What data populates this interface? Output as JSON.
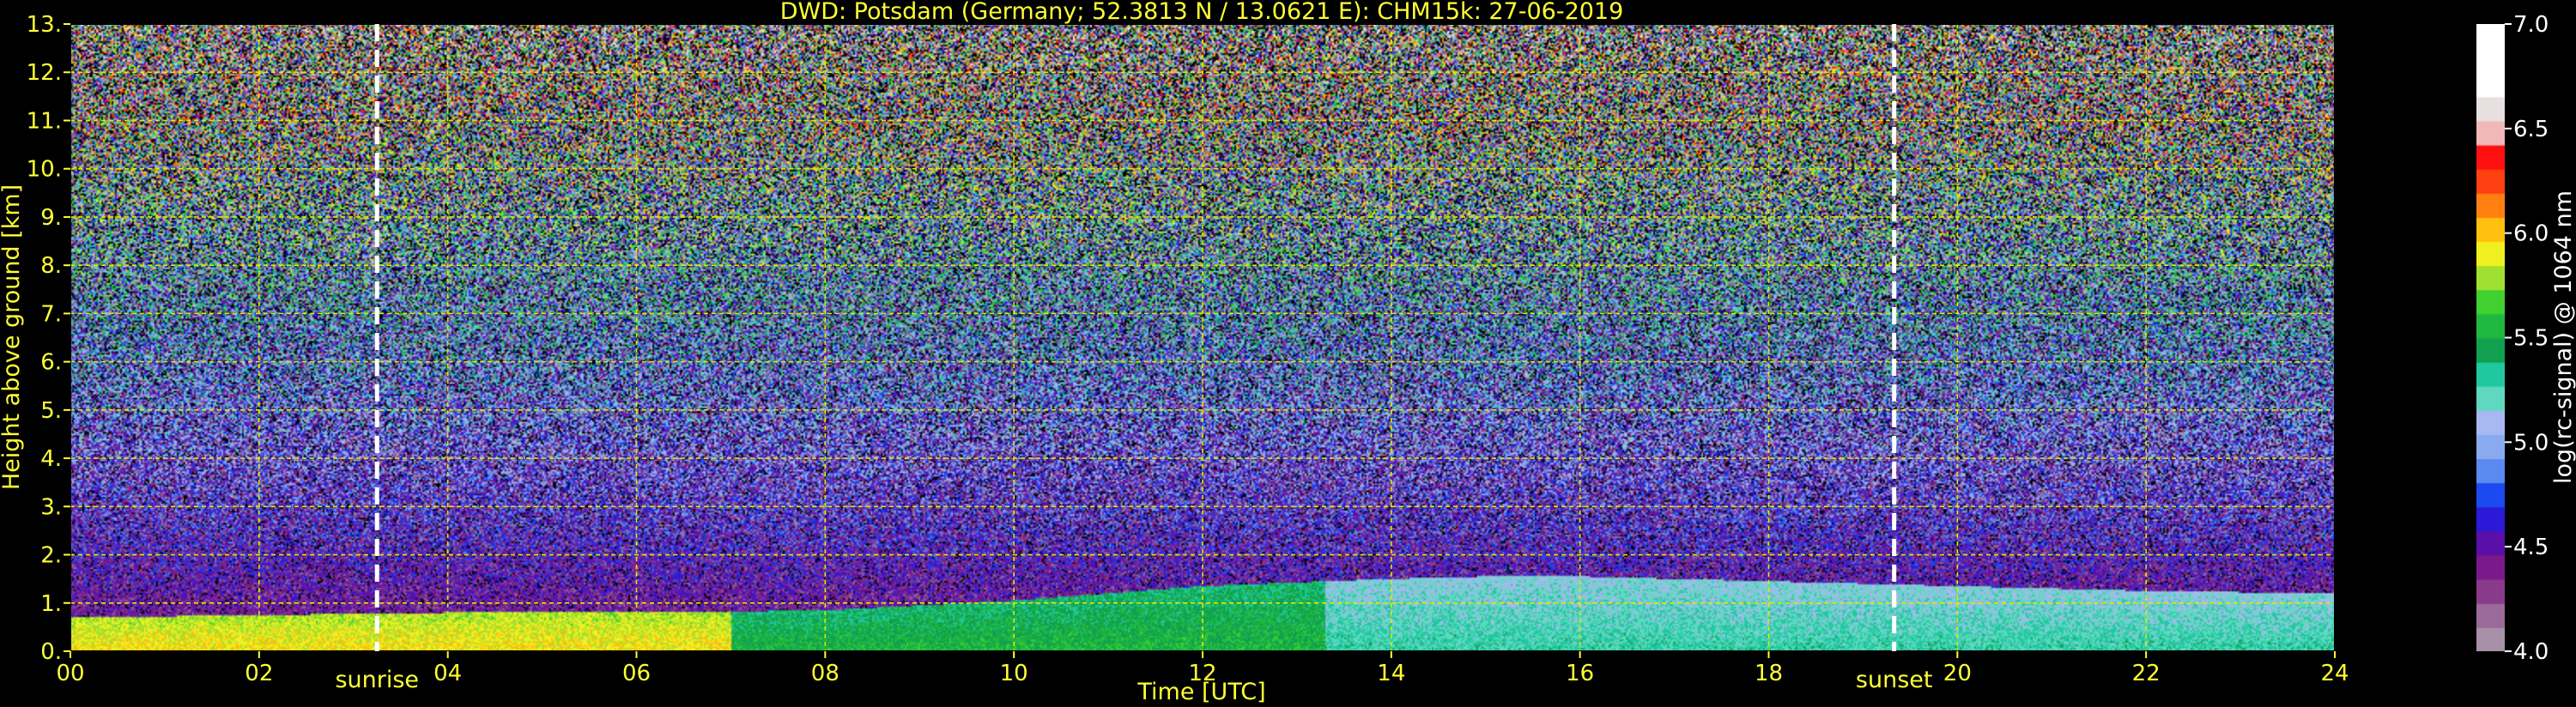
{
  "chart_data": {
    "type": "heatmap",
    "title": "DWD: Potsdam (Germany; 52.3813 N / 13.0621 E):    CHM15k: 27-06-2019",
    "xlabel": "Time [UTC]",
    "ylabel": "Height above ground [km]",
    "xlim": [
      0,
      24
    ],
    "ylim": [
      0,
      13
    ],
    "x_ticks": [
      "00",
      "02",
      "04",
      "06",
      "08",
      "10",
      "12",
      "14",
      "16",
      "18",
      "20",
      "22",
      "24"
    ],
    "y_ticks": [
      "0.",
      "1.",
      "2.",
      "3.",
      "4.",
      "5.",
      "6.",
      "7.",
      "8.",
      "9.",
      "10.",
      "11.",
      "12.",
      "13."
    ],
    "grid": true,
    "markers": [
      {
        "label": "sunrise",
        "x": 3.25
      },
      {
        "label": "sunset",
        "x": 19.33
      }
    ],
    "boundary_layer_top_km": [
      {
        "x": 0,
        "y": 0.7
      },
      {
        "x": 2,
        "y": 0.75
      },
      {
        "x": 4,
        "y": 0.8
      },
      {
        "x": 6,
        "y": 0.8
      },
      {
        "x": 8,
        "y": 0.85
      },
      {
        "x": 10,
        "y": 1.05
      },
      {
        "x": 12,
        "y": 1.35
      },
      {
        "x": 13.3,
        "y": 1.45
      },
      {
        "x": 14,
        "y": 1.5
      },
      {
        "x": 15,
        "y": 1.55
      },
      {
        "x": 16,
        "y": 1.55
      },
      {
        "x": 18,
        "y": 1.45
      },
      {
        "x": 20,
        "y": 1.35
      },
      {
        "x": 22,
        "y": 1.25
      },
      {
        "x": 24,
        "y": 1.2
      }
    ],
    "colorbar": {
      "label": "log(rc-signal) @ 1064 nm",
      "min": 4.0,
      "max": 7.0,
      "ticks": [
        "4.0",
        "4.5",
        "5.0",
        "5.5",
        "6.0",
        "6.5",
        "7.0"
      ],
      "colors": [
        "#a890a8",
        "#9a6a9a",
        "#8a3a8a",
        "#7a1a8a",
        "#5a10a8",
        "#2a1ad8",
        "#1a4af0",
        "#5a8af0",
        "#8aaaf0",
        "#a8b8f0",
        "#60d8c0",
        "#20c8a0",
        "#10a050",
        "#20b840",
        "#40d030",
        "#a0e030",
        "#f0f020",
        "#ffc010",
        "#ff8010",
        "#ff4010",
        "#ff1010",
        "#f0b8b8",
        "#e8e0e0",
        "#ffffff",
        "#ffffff",
        "#ffffff"
      ]
    }
  }
}
